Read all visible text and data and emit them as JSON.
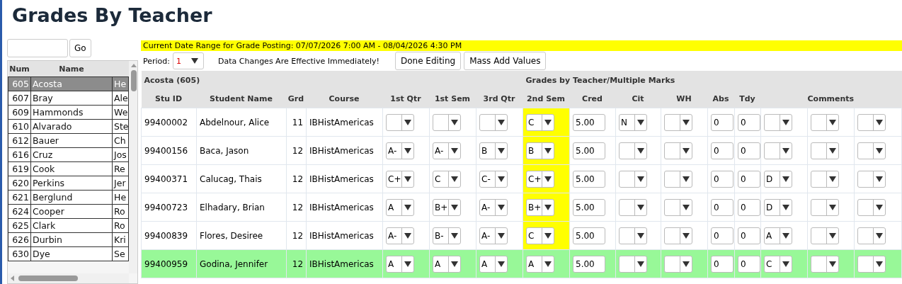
{
  "page_title": "Grades By Teacher",
  "teacher_search": {
    "button": "Go"
  },
  "teacher_list": {
    "columns": [
      "Num",
      "Name"
    ],
    "rows": [
      {
        "num": "605",
        "name": "Acosta",
        "column_3": "He",
        "selected": true
      },
      {
        "num": "607",
        "name": "Bray",
        "column_3": "Ale",
        "selected": false
      },
      {
        "num": "609",
        "name": "Hammonds",
        "column_3": "We",
        "selected": false
      },
      {
        "num": "610",
        "name": "Alvarado",
        "column_3": "Ste",
        "selected": false
      },
      {
        "num": "612",
        "name": "Bauer",
        "column_3": "Ch",
        "selected": false
      },
      {
        "num": "616",
        "name": "Cruz",
        "column_3": "Jos",
        "selected": false
      },
      {
        "num": "619",
        "name": "Cook",
        "column_3": "Re",
        "selected": false
      },
      {
        "num": "620",
        "name": "Perkins",
        "column_3": "Jer",
        "selected": false
      },
      {
        "num": "621",
        "name": "Berglund",
        "column_3": "He",
        "selected": false
      },
      {
        "num": "624",
        "name": "Cooper",
        "column_3": "Ro",
        "selected": false
      },
      {
        "num": "625",
        "name": "Clark",
        "column_3": "Ro",
        "selected": false
      },
      {
        "num": "626",
        "name": "Durbin",
        "column_3": "Kri",
        "selected": false
      },
      {
        "num": "630",
        "name": "Dye",
        "column_3": "Se",
        "selected": false
      }
    ]
  },
  "posting_banner": "Current Date Range for Grade Posting: 07/07/2026 7:00 AM - 08/04/2026 4:30 PM",
  "period": {
    "label": "Period:",
    "value": "1"
  },
  "notice": "Data Changes Are Effective Immediately!",
  "buttons": [
    "Done Editing",
    "Mass Add Values"
  ],
  "grid": {
    "teacher": "Acosta (605)",
    "title": "Grades by Teacher/Multiple Marks",
    "columns": [
      {
        "label": "Stu ID",
        "kind": "text",
        "highlighted": false
      },
      {
        "label": "Student Name",
        "kind": "text",
        "highlighted": false
      },
      {
        "label": "Grd",
        "kind": "text",
        "highlighted": false
      },
      {
        "label": "Course",
        "kind": "text",
        "highlighted": false
      },
      {
        "label": "1st Qtr",
        "kind": "select",
        "highlighted": false
      },
      {
        "label": "1st Sem",
        "kind": "select",
        "highlighted": false
      },
      {
        "label": "3rd Qtr",
        "kind": "select",
        "highlighted": false
      },
      {
        "label": "2nd Sem",
        "kind": "select",
        "highlighted": true
      },
      {
        "label": "Cred",
        "kind": "input",
        "highlighted": false
      },
      {
        "label": "Cit",
        "kind": "select",
        "highlighted": false
      },
      {
        "label": "WH",
        "kind": "select",
        "highlighted": false
      },
      {
        "label": "Abs",
        "kind": "input",
        "highlighted": false
      },
      {
        "label": "Tdy",
        "kind": "input",
        "highlighted": false
      },
      {
        "kind": "select",
        "highlighted": false
      },
      {
        "label": "Comments",
        "kind": "select",
        "highlighted": false
      },
      {
        "kind": "select",
        "highlighted": false
      }
    ],
    "rows": [
      {
        "selected": false,
        "cells": [
          "99400002",
          "Abdelnour, Alice",
          "11",
          "IBHistAmericas",
          null,
          null,
          null,
          "C",
          "5.00",
          "N",
          null,
          "0",
          "0",
          null,
          null,
          null
        ]
      },
      {
        "selected": false,
        "cells": [
          "99400156",
          "Baca, Jason",
          "12",
          "IBHistAmericas",
          "A-",
          "A-",
          "B",
          "B",
          "5.00",
          null,
          null,
          "0",
          "0",
          null,
          null,
          null
        ]
      },
      {
        "selected": false,
        "cells": [
          "99400371",
          "Calucag, Thais",
          "12",
          "IBHistAmericas",
          "C+",
          "C",
          "C-",
          "C+",
          "5.00",
          null,
          null,
          "0",
          "0",
          "D",
          null,
          null
        ]
      },
      {
        "selected": false,
        "cells": [
          "99400723",
          "Elhadary, Brian",
          "12",
          "IBHistAmericas",
          "A",
          "B+",
          "A-",
          "B+",
          "5.00",
          null,
          null,
          "0",
          "0",
          "D",
          null,
          null
        ]
      },
      {
        "selected": false,
        "cells": [
          "99400839",
          "Flores, Desiree",
          "12",
          "IBHistAmericas",
          "A-",
          "B-",
          "A-",
          "C",
          "5.00",
          null,
          null,
          "0",
          "0",
          "A",
          null,
          null
        ]
      },
      {
        "selected": true,
        "cells": [
          "99400959",
          "Godina, Jennifer",
          "12",
          "IBHistAmericas",
          "A",
          "A",
          "A",
          "A",
          "5.00",
          null,
          null,
          "0",
          "0",
          "C",
          null,
          null
        ]
      }
    ]
  }
}
